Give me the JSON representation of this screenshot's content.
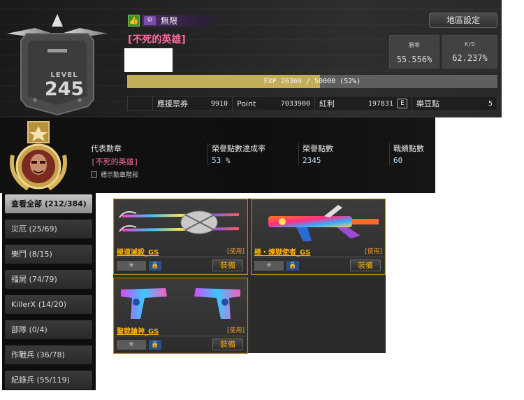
{
  "profile": {
    "level_label": "LEVEL",
    "level": "245",
    "status_text": "無限",
    "player_name": "[不死的英雄]",
    "map_settings_label": "地區設定",
    "win_rate_label": "勝率",
    "win_rate": "55.556%",
    "kd_label": "K/D",
    "kd": "62.237%",
    "exp_text": "EXP 26369 / 50000 (52%)",
    "exp_progress": 0.52,
    "currencies": [
      {
        "label": "應援票券",
        "value": "9910"
      },
      {
        "label": "Point",
        "value": "7033900"
      },
      {
        "label": "紅利",
        "value": "197831"
      },
      {
        "label": "樂豆點",
        "value": "5"
      }
    ]
  },
  "medal_panel": {
    "rep_medal_label": "代表勳章",
    "rep_medal_value": "[不死的英雄]",
    "show_stage_label": "標示勳章階段",
    "honor_rate_label": "榮譽點數達成率",
    "honor_rate_value": "53 %",
    "honor_points_label": "榮譽點數",
    "honor_points_value": "2345",
    "record_points_label": "戰績點數",
    "record_points_value": "60"
  },
  "categories": [
    {
      "label": "查看全部 (212/384)",
      "active": true
    },
    {
      "label": "災厄 (25/69)"
    },
    {
      "label": "樂鬥 (8/15)"
    },
    {
      "label": "殭屍 (74/79)"
    },
    {
      "label": "KillerX (14/20)"
    },
    {
      "label": "部隊 (0/4)"
    },
    {
      "label": "作戰兵 (36/78)"
    },
    {
      "label": "紀錄兵 (55/119)"
    }
  ],
  "weapons": [
    {
      "name": "極道滅殺_GS",
      "status": "[使用]",
      "equip_label": "裝備",
      "star": "★",
      "lock": "🔒"
    },
    {
      "name": "極・煉獄使者_GS",
      "status": "[使用]",
      "equip_label": "裝備",
      "star": "★",
      "lock": "🔒"
    },
    {
      "name": "聖裁鎗神_GS",
      "status": "[使用]",
      "equip_label": "裝備",
      "star": "★",
      "lock": "🔒"
    }
  ],
  "icons": {
    "thumb": "👍",
    "status": "⚙",
    "currency": "E"
  },
  "colors": {
    "name_pink": "#ff6aa3",
    "exp_gold": "#c3ad56",
    "weapon_gold": "#ffb400",
    "card_border": "#b48a2a"
  }
}
